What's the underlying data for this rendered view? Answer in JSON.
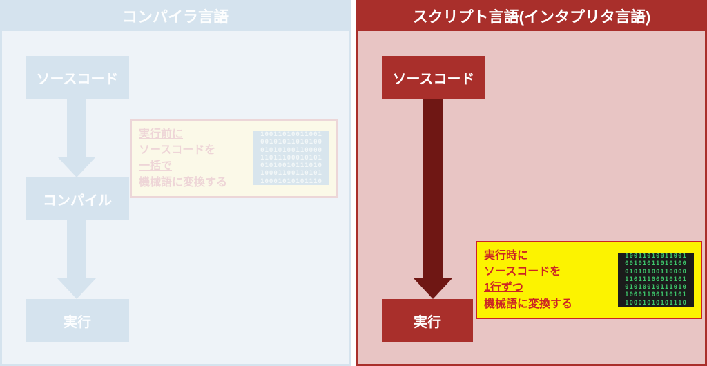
{
  "left": {
    "title": "コンパイラ言語",
    "boxes": {
      "source": "ソースコード",
      "compile": "コンパイル",
      "run": "実行"
    },
    "callout": {
      "line1": "実行前に",
      "line2": "ソースコードを",
      "line3": "一括で",
      "line4": "機械語に変換する"
    }
  },
  "right": {
    "title": "スクリプト言語(インタプリタ言語)",
    "boxes": {
      "source": "ソースコード",
      "run": "実行"
    },
    "callout": {
      "line1": "実行時に",
      "line2": "ソースコードを",
      "line3": "1行ずつ",
      "line4": "機械語に変換する"
    }
  },
  "binary_rows": [
    "10011010011001",
    "00101011010100",
    "01010100110000",
    "11011100010101",
    "01010010111010",
    "10001100110101",
    "10001010101110"
  ]
}
